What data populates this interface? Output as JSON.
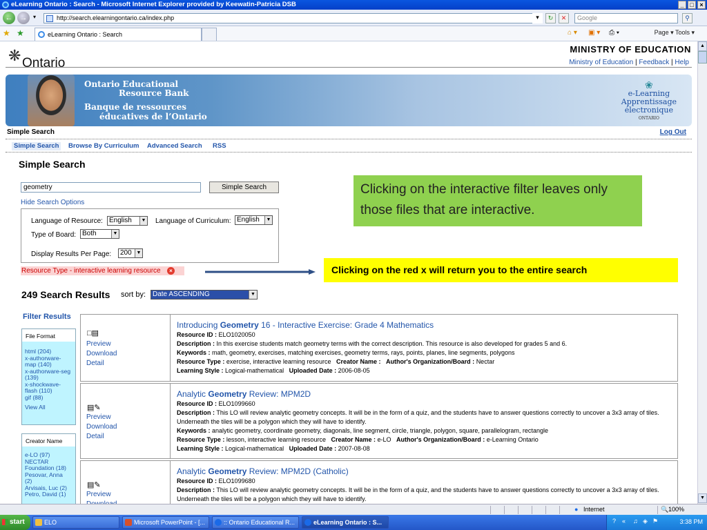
{
  "window": {
    "title": "eLearning Ontario : Search - Microsoft Internet Explorer provided by Keewatin-Patricia DSB",
    "controls": [
      "_",
      "□",
      "×"
    ]
  },
  "browser": {
    "url": "http://search.elearningontario.ca/index.php",
    "search_placeholder": "Google",
    "tab_title": "eLearning Ontario : Search",
    "tools": "Page ▾  Tools ▾"
  },
  "header": {
    "logo_text": "Ontario",
    "ministry": "MINISTRY OF EDUCATION",
    "links": [
      "Ministry of Education",
      "Feedback",
      "Help"
    ],
    "banner_lines": [
      "Ontario Educational",
      "Resource Bank",
      "Banque de ressources",
      "éducatives de l’Ontario"
    ],
    "elearn_lines": [
      "e-Learning",
      "Apprentissage",
      "électronique",
      "ONTARIO"
    ]
  },
  "crumb": "Simple Search",
  "logout": "Log Out",
  "subnav": [
    "Simple Search",
    "Browse By Curriculum",
    "Advanced Search",
    "RSS"
  ],
  "search": {
    "title": "Simple Search",
    "query": "geometry",
    "button": "Simple Search",
    "hide_options": "Hide Search Options",
    "lang_resource_label": "Language of Resource:",
    "lang_resource_value": "English",
    "lang_curriculum_label": "Language of Curriculum:",
    "lang_curriculum_value": "English",
    "board_label": "Type of Board:",
    "board_value": "Both",
    "per_page_label": "Display Results Per Page:",
    "per_page_value": "200",
    "resource_type_filter": "Resource Type - interactive learning resource"
  },
  "results_header": {
    "count_text": "249 Search Results",
    "sort_label": "sort by:",
    "sort_value": "Date ASCENDING"
  },
  "filters": {
    "title": "Filter Results",
    "format_header": "File Format",
    "format_items": [
      "html (204)",
      "x-authorware-",
      "map (140)",
      "x-authorware-seg",
      "(139)",
      "x-shockwave-",
      "flash (110)",
      "gif (88)"
    ],
    "format_view_all": "View All",
    "creator_header": "Creator Name",
    "creator_items": [
      "e-LO (97)",
      "NECTAR",
      "Foundation (18)",
      "Pesovar, Anna",
      "(2)",
      "Arvisais, Luc (2)",
      "Petro, David (1)"
    ]
  },
  "row_links": [
    "Preview",
    "Download",
    "Detail"
  ],
  "results": [
    {
      "title_pre": "Introducing ",
      "title_bold": "Geometry",
      "title_post": " 16 - Interactive Exercise: Grade 4 Mathematics",
      "resource_id": "ELO1020050",
      "description": "In this exercise students match geometry terms with the correct description. This resource is also developed for grades 5 and 6.",
      "keywords": "math, geometry, exercises, matching exercises, geometry terms, rays, points, planes, line segments, polygons",
      "resource_type": "exercise, interactive learning resource",
      "creator": "",
      "org": "Nectar",
      "learning_style": "Logical-mathematical",
      "uploaded": "2006-08-05"
    },
    {
      "title_pre": "Analytic ",
      "title_bold": "Geometry",
      "title_post": " Review: MPM2D",
      "resource_id": "ELO1099660",
      "description": "This LO will review analytic geometry concepts. It will be in the form of a quiz, and the students have to answer questions correctly to uncover a 3x3 array of tiles. Underneath the tiles will be a polygon which they will have to identify.",
      "keywords": "analytic geometry, coordinate geometry, diagonals, line segment, circle, triangle, polygon, square, parallelogram, rectangle",
      "resource_type": "lesson, interactive learning resource",
      "creator": "e-LO",
      "org": "e-Learning Ontario",
      "learning_style": "Logical-mathematical",
      "uploaded": "2007-08-08"
    },
    {
      "title_pre": "Analytic ",
      "title_bold": "Geometry",
      "title_post": " Review: MPM2D (Catholic)",
      "resource_id": "ELO1099680",
      "description": "This LO will review analytic geometry concepts. It will be in the form of a quiz, and the students have to answer questions correctly to uncover a 3x3 array of tiles. Underneath the tiles will be a polygon which they will have to identify."
    }
  ],
  "labels": {
    "resource_id": "Resource ID :",
    "description": "Description :",
    "keywords": "Keywords :",
    "resource_type": "Resource Type :",
    "creator": "Creator Name :",
    "org": "Author's Organization/Board :",
    "learning_style": "Learning Style :",
    "uploaded": "Uploaded Date :"
  },
  "callouts": {
    "green": "Clicking on the interactive filter leaves only those files that are interactive.",
    "yellow": "Clicking on the red x will return you to the entire search"
  },
  "status": {
    "zone": "Internet",
    "zoom": "100%"
  },
  "taskbar": {
    "start": "start",
    "items": [
      "ELO",
      "Microsoft PowerPoint - [...",
      ":: Ontario Educational R...",
      "eLearning Ontario : S..."
    ],
    "clock": "3:38 PM"
  },
  "colors": {
    "link": "#2255aa",
    "callout_green": "#8fd14f",
    "callout_yellow": "#ffff00",
    "filter_bg": "#bff4ff"
  }
}
